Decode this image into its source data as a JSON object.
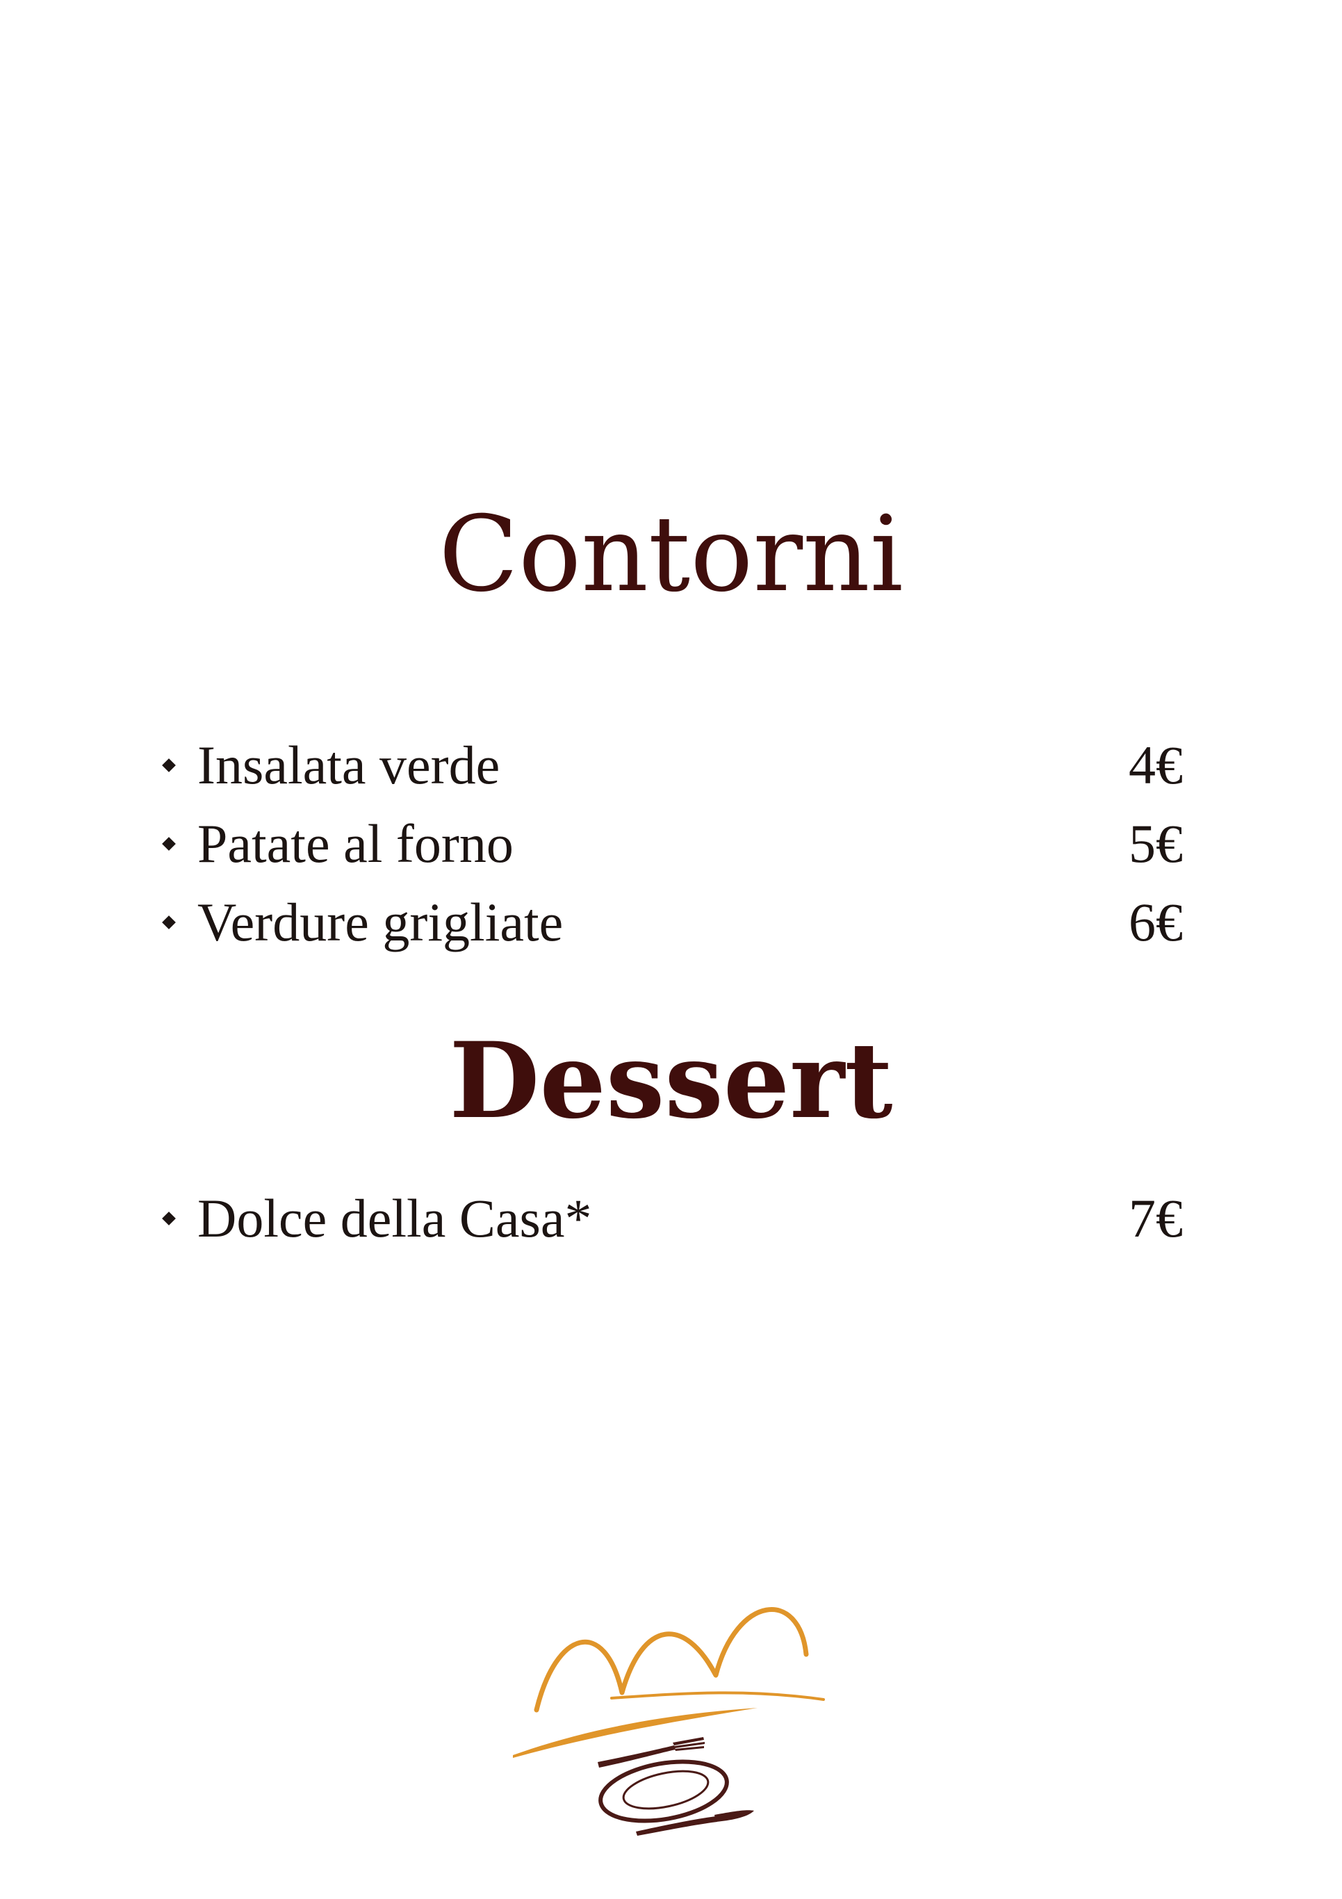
{
  "sections": [
    {
      "title": "Contorni",
      "items": [
        {
          "name": "Insalata verde",
          "price": "4€"
        },
        {
          "name": "Patate al forno",
          "price": "5€"
        },
        {
          "name": "Verdure grigliate",
          "price": "6€"
        }
      ]
    },
    {
      "title": "Dessert",
      "items": [
        {
          "name": "Dolce della Casa*",
          "price": "7€"
        }
      ]
    }
  ],
  "colors": {
    "heading": "#3f0e0c",
    "text": "#1c1412",
    "logo_orange": "#e0952a",
    "logo_brown": "#4a1a16"
  },
  "logo": {
    "icon": "restaurant-logo-arches-plate-cutlery"
  }
}
